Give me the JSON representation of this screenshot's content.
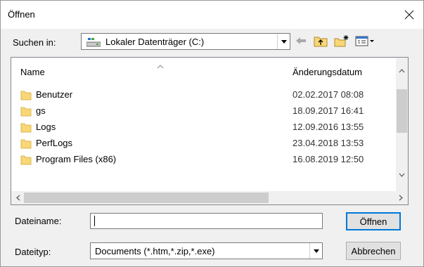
{
  "window": {
    "title": "Öffnen"
  },
  "look_in": {
    "label": "Suchen in:",
    "value": "Lokaler Datenträger (C:)",
    "icon": "drive-icon"
  },
  "toolbar": {
    "icons": [
      "back-arrow-icon",
      "up-folder-icon",
      "new-folder-icon",
      "view-menu-icon"
    ]
  },
  "file_list": {
    "columns": [
      "Name",
      "Änderungsdatum"
    ],
    "rows": [
      {
        "name": "Benutzer",
        "date": "02.02.2017 08:08"
      },
      {
        "name": "gs",
        "date": "18.09.2017 16:41"
      },
      {
        "name": "Logs",
        "date": "12.09.2016 13:55"
      },
      {
        "name": "PerfLogs",
        "date": "23.04.2018 13:53"
      },
      {
        "name": "Program Files (x86)",
        "date": "16.08.2019 12:50"
      }
    ]
  },
  "filename": {
    "label": "Dateiname:",
    "value": "",
    "placeholder": ""
  },
  "filetype": {
    "label": "Dateityp:",
    "value": "Documents (*.htm,*.zip,*.exe)"
  },
  "buttons": {
    "open": "Öffnen",
    "cancel": "Abbrechen"
  },
  "colors": {
    "accent": "#0078d7",
    "folder": "#f8d775",
    "list_border": "#828790"
  }
}
